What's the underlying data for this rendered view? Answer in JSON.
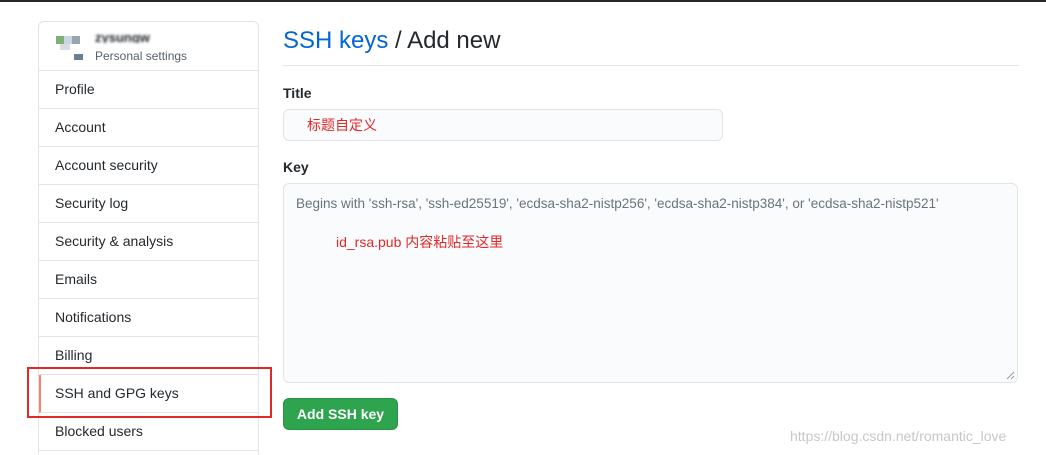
{
  "sidebar": {
    "username": "zysungw",
    "subtitle": "Personal settings",
    "items": [
      {
        "label": "Profile"
      },
      {
        "label": "Account"
      },
      {
        "label": "Account security"
      },
      {
        "label": "Security log"
      },
      {
        "label": "Security & analysis"
      },
      {
        "label": "Emails"
      },
      {
        "label": "Notifications"
      },
      {
        "label": "Billing"
      },
      {
        "label": "SSH and GPG keys",
        "selected": true
      },
      {
        "label": "Blocked users"
      }
    ]
  },
  "header": {
    "breadcrumb_link": "SSH keys",
    "separator": " / ",
    "current": "Add new"
  },
  "form": {
    "title_label": "Title",
    "title_value": "标题自定义",
    "key_label": "Key",
    "key_placeholder": "Begins with 'ssh-rsa', 'ssh-ed25519', 'ecdsa-sha2-nistp256', 'ecdsa-sha2-nistp384', or 'ecdsa-sha2-nistp521'",
    "key_annotation": "id_rsa.pub 内容粘贴至这里",
    "submit_label": "Add SSH key"
  },
  "watermark": "https://blog.csdn.net/romantic_love",
  "colors": {
    "link": "#0366d6",
    "primary_button": "#2ea44f",
    "annotation_red": "#e02929",
    "selected_indicator": "#f9826c",
    "border": "#e1e4e8"
  }
}
